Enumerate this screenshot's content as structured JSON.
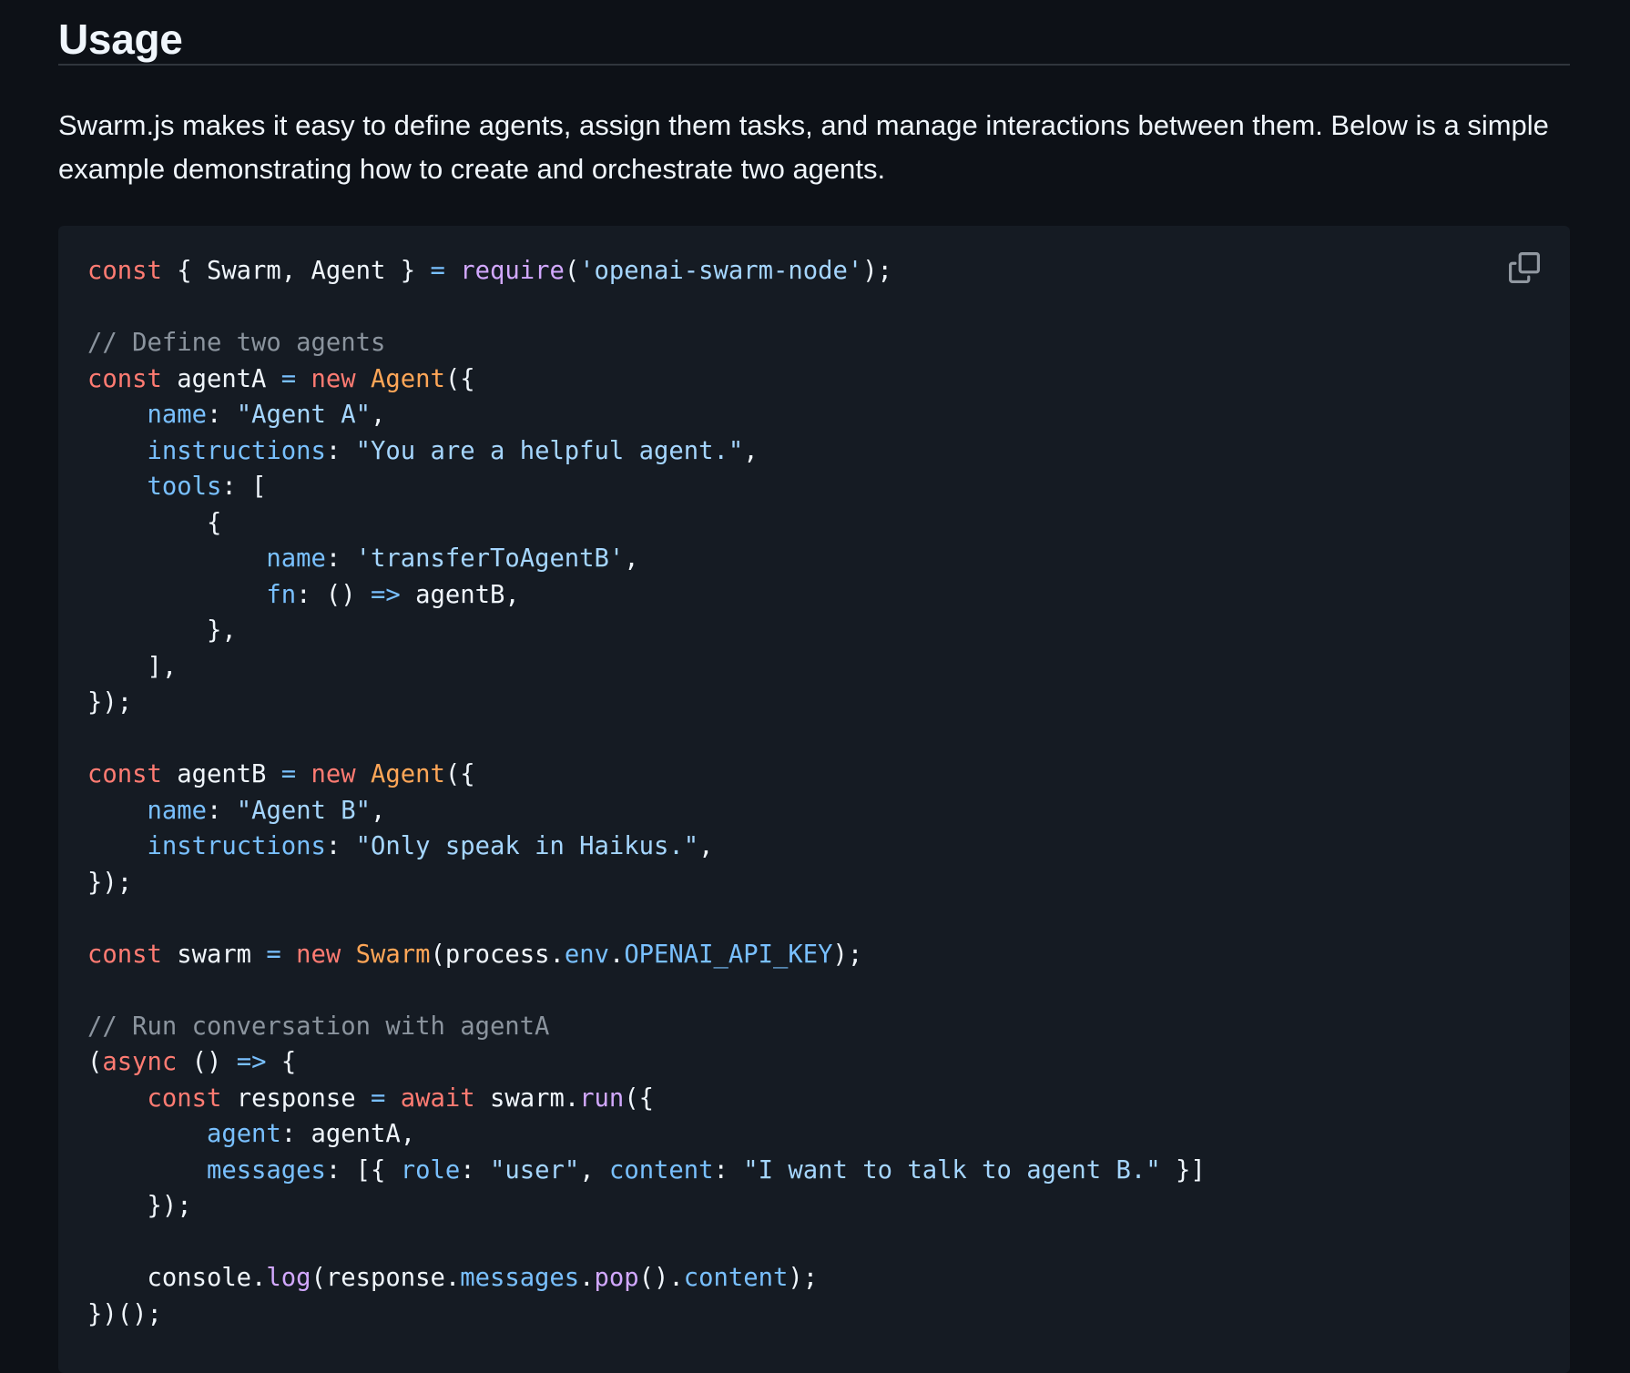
{
  "section": {
    "title": "Usage",
    "description": "Swarm.js makes it easy to define agents, assign them tasks, and manage interactions between them. Below is a simple example demonstrating how to create and orchestrate two agents."
  },
  "code_block": {
    "copy_icon": "copy-icon",
    "colors": {
      "background": "#151b23",
      "keyword": "#ff7b72",
      "function": "#d2a8ff",
      "class": "#ffa657",
      "string": "#a5d6ff",
      "property": "#79c0ff",
      "comment": "#8b949e",
      "text": "#f0f6fc"
    },
    "lines": [
      [
        [
          "kw",
          "const"
        ],
        [
          "txt",
          " { Swarm, Agent } "
        ],
        [
          "prop",
          "="
        ],
        [
          "txt",
          " "
        ],
        [
          "fn",
          "require"
        ],
        [
          "txt",
          "("
        ],
        [
          "str",
          "'openai-swarm-node'"
        ],
        [
          "txt",
          ");"
        ]
      ],
      [],
      [
        [
          "com",
          "// Define two agents"
        ]
      ],
      [
        [
          "kw",
          "const"
        ],
        [
          "txt",
          " agentA "
        ],
        [
          "prop",
          "="
        ],
        [
          "txt",
          " "
        ],
        [
          "kw",
          "new"
        ],
        [
          "txt",
          " "
        ],
        [
          "cls",
          "Agent"
        ],
        [
          "txt",
          "({"
        ]
      ],
      [
        [
          "txt",
          "    "
        ],
        [
          "prop",
          "name"
        ],
        [
          "txt",
          ": "
        ],
        [
          "str",
          "\"Agent A\""
        ],
        [
          "txt",
          ","
        ]
      ],
      [
        [
          "txt",
          "    "
        ],
        [
          "prop",
          "instructions"
        ],
        [
          "txt",
          ": "
        ],
        [
          "str",
          "\"You are a helpful agent.\""
        ],
        [
          "txt",
          ","
        ]
      ],
      [
        [
          "txt",
          "    "
        ],
        [
          "prop",
          "tools"
        ],
        [
          "txt",
          ": ["
        ]
      ],
      [
        [
          "txt",
          "        {"
        ]
      ],
      [
        [
          "txt",
          "            "
        ],
        [
          "prop",
          "name"
        ],
        [
          "txt",
          ": "
        ],
        [
          "str",
          "'transferToAgentB'"
        ],
        [
          "txt",
          ","
        ]
      ],
      [
        [
          "txt",
          "            "
        ],
        [
          "prop",
          "fn"
        ],
        [
          "txt",
          ": () "
        ],
        [
          "prop",
          "=>"
        ],
        [
          "txt",
          " agentB,"
        ]
      ],
      [
        [
          "txt",
          "        },"
        ]
      ],
      [
        [
          "txt",
          "    ],"
        ]
      ],
      [
        [
          "txt",
          "});"
        ]
      ],
      [],
      [
        [
          "kw",
          "const"
        ],
        [
          "txt",
          " agentB "
        ],
        [
          "prop",
          "="
        ],
        [
          "txt",
          " "
        ],
        [
          "kw",
          "new"
        ],
        [
          "txt",
          " "
        ],
        [
          "cls",
          "Agent"
        ],
        [
          "txt",
          "({"
        ]
      ],
      [
        [
          "txt",
          "    "
        ],
        [
          "prop",
          "name"
        ],
        [
          "txt",
          ": "
        ],
        [
          "str",
          "\"Agent B\""
        ],
        [
          "txt",
          ","
        ]
      ],
      [
        [
          "txt",
          "    "
        ],
        [
          "prop",
          "instructions"
        ],
        [
          "txt",
          ": "
        ],
        [
          "str",
          "\"Only speak in Haikus.\""
        ],
        [
          "txt",
          ","
        ]
      ],
      [
        [
          "txt",
          "});"
        ]
      ],
      [],
      [
        [
          "kw",
          "const"
        ],
        [
          "txt",
          " swarm "
        ],
        [
          "prop",
          "="
        ],
        [
          "txt",
          " "
        ],
        [
          "kw",
          "new"
        ],
        [
          "txt",
          " "
        ],
        [
          "cls",
          "Swarm"
        ],
        [
          "txt",
          "(process."
        ],
        [
          "prop",
          "env"
        ],
        [
          "txt",
          "."
        ],
        [
          "prop",
          "OPENAI_API_KEY"
        ],
        [
          "txt",
          ");"
        ]
      ],
      [],
      [
        [
          "com",
          "// Run conversation with agentA"
        ]
      ],
      [
        [
          "txt",
          "("
        ],
        [
          "kw",
          "async"
        ],
        [
          "txt",
          " () "
        ],
        [
          "prop",
          "=>"
        ],
        [
          "txt",
          " {"
        ]
      ],
      [
        [
          "txt",
          "    "
        ],
        [
          "kw",
          "const"
        ],
        [
          "txt",
          " response "
        ],
        [
          "prop",
          "="
        ],
        [
          "txt",
          " "
        ],
        [
          "kw",
          "await"
        ],
        [
          "txt",
          " swarm."
        ],
        [
          "fn",
          "run"
        ],
        [
          "txt",
          "({"
        ]
      ],
      [
        [
          "txt",
          "        "
        ],
        [
          "prop",
          "agent"
        ],
        [
          "txt",
          ": agentA,"
        ]
      ],
      [
        [
          "txt",
          "        "
        ],
        [
          "prop",
          "messages"
        ],
        [
          "txt",
          ": [{ "
        ],
        [
          "prop",
          "role"
        ],
        [
          "txt",
          ": "
        ],
        [
          "str",
          "\"user\""
        ],
        [
          "txt",
          ", "
        ],
        [
          "prop",
          "content"
        ],
        [
          "txt",
          ": "
        ],
        [
          "str",
          "\"I want to talk to agent B.\""
        ],
        [
          "txt",
          " }]"
        ]
      ],
      [
        [
          "txt",
          "    });"
        ]
      ],
      [],
      [
        [
          "txt",
          "    console."
        ],
        [
          "fn",
          "log"
        ],
        [
          "txt",
          "(response."
        ],
        [
          "prop",
          "messages"
        ],
        [
          "txt",
          "."
        ],
        [
          "fn",
          "pop"
        ],
        [
          "txt",
          "()."
        ],
        [
          "prop",
          "content"
        ],
        [
          "txt",
          ");"
        ]
      ],
      [
        [
          "txt",
          "})();"
        ]
      ]
    ]
  }
}
